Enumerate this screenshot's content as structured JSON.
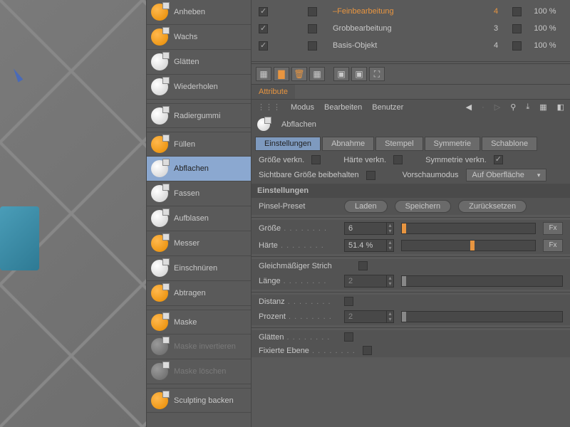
{
  "tools": [
    {
      "label": "Anheben",
      "cls": "orange",
      "sep": false
    },
    {
      "label": "Wachs",
      "cls": "orange",
      "sep": false
    },
    {
      "label": "Glätten",
      "cls": "white",
      "sep": false
    },
    {
      "label": "Wiederholen",
      "cls": "white",
      "sep": false
    },
    {
      "label": "Radiergummi",
      "cls": "white",
      "sep": true
    },
    {
      "label": "Füllen",
      "cls": "orange",
      "sep": true
    },
    {
      "label": "Abflachen",
      "cls": "white",
      "sep": false,
      "active": true
    },
    {
      "label": "Fassen",
      "cls": "white",
      "sep": false
    },
    {
      "label": "Aufblasen",
      "cls": "white",
      "sep": false
    },
    {
      "label": "Messer",
      "cls": "orange",
      "sep": false
    },
    {
      "label": "Einschnüren",
      "cls": "white",
      "sep": false
    },
    {
      "label": "Abtragen",
      "cls": "orange",
      "sep": false
    },
    {
      "label": "Maske",
      "cls": "orange",
      "sep": true
    },
    {
      "label": "Maske invertieren",
      "cls": "gray",
      "sep": false,
      "disabled": true
    },
    {
      "label": "Maske löschen",
      "cls": "gray",
      "sep": false,
      "disabled": true
    },
    {
      "label": "Sculpting backen",
      "cls": "orange",
      "sep": true
    }
  ],
  "layers": [
    {
      "name": "Feinbearbeitung",
      "v1": "4",
      "v2": "100 %",
      "hl": true
    },
    {
      "name": "Grobbearbeitung",
      "v1": "3",
      "v2": "100 %",
      "hl": false
    },
    {
      "name": "Basis-Objekt",
      "v1": "4",
      "v2": "100 %",
      "hl": false
    }
  ],
  "attribute_tab": "Attribute",
  "menu": {
    "modus": "Modus",
    "bearbeiten": "Bearbeiten",
    "benutzer": "Benutzer"
  },
  "header_title": "Abflachen",
  "subtabs": [
    "Einstellungen",
    "Abnahme",
    "Stempel",
    "Symmetrie",
    "Schablone"
  ],
  "row1": {
    "a": "Größe verkn.",
    "b": "Härte verkn.",
    "c": "Symmetrie verkn."
  },
  "row2": {
    "a": "Sichtbare Größe beibehalten",
    "b": "Vorschaumodus",
    "sel": "Auf Oberfläche"
  },
  "section": "Einstellungen",
  "preset": {
    "label": "Pinsel-Preset",
    "load": "Laden",
    "save": "Speichern",
    "reset": "Zurücksetzen"
  },
  "size": {
    "label": "Größe",
    "val": "6",
    "fx": "Fx"
  },
  "hardness": {
    "label": "Härte",
    "val": "51.4 %",
    "pct": 51.4,
    "fx": "Fx"
  },
  "stroke": {
    "label": "Gleichmäßiger Strich"
  },
  "length": {
    "label": "Länge",
    "val": "2"
  },
  "distance": {
    "label": "Distanz"
  },
  "percent": {
    "label": "Prozent",
    "val": "2"
  },
  "smooth": {
    "label": "Glätten"
  },
  "fixed": {
    "label": "Fixierte Ebene"
  }
}
